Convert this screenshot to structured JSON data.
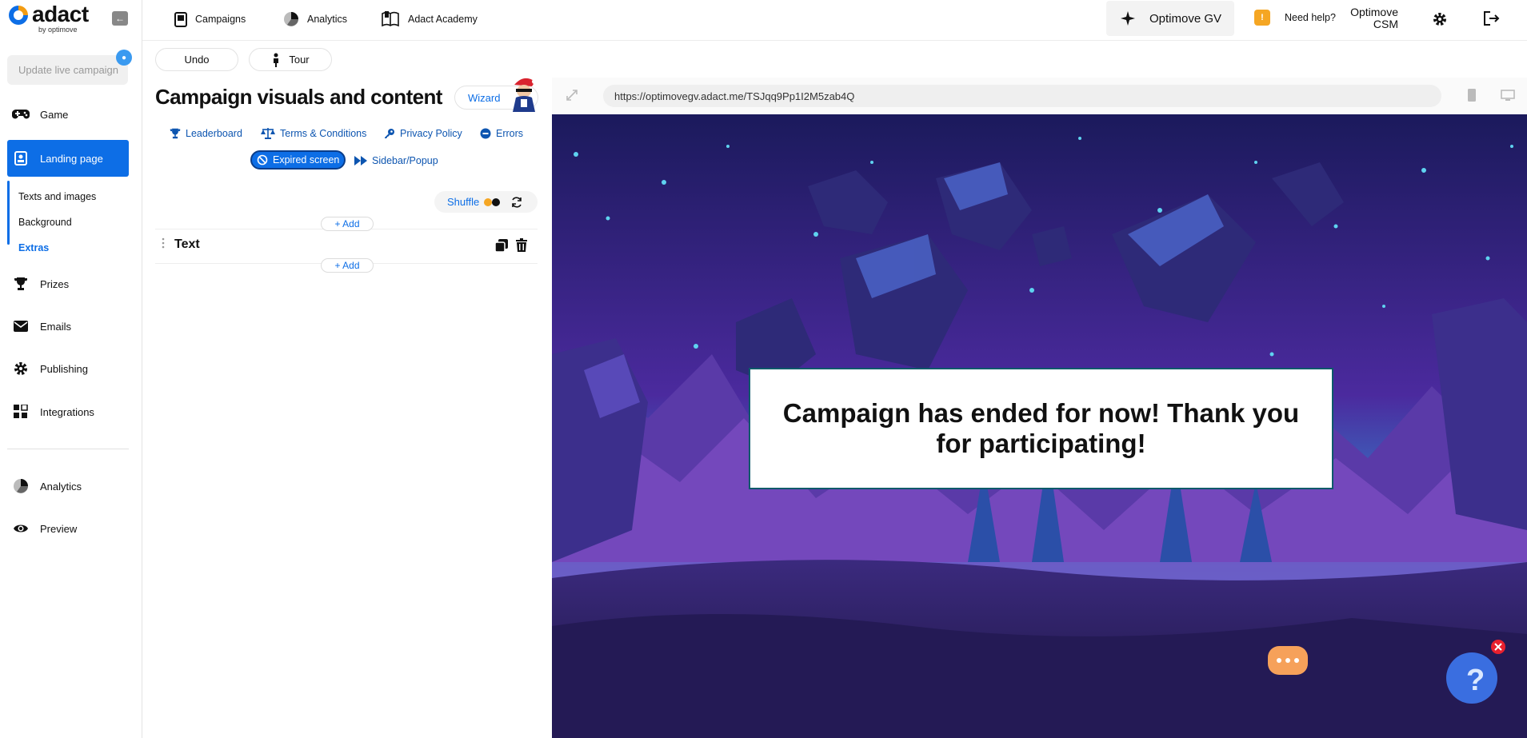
{
  "brand": {
    "name": "adact",
    "tagline": "by optimove"
  },
  "sidebar": {
    "update_label": "Update live campaign",
    "items": [
      {
        "label": "Game",
        "icon": "gamepad-icon"
      },
      {
        "label": "Landing page",
        "icon": "landing-page-icon"
      },
      {
        "label": "Prizes",
        "icon": "trophy-icon"
      },
      {
        "label": "Emails",
        "icon": "envelope-icon"
      },
      {
        "label": "Publishing",
        "icon": "gear-icon"
      },
      {
        "label": "Integrations",
        "icon": "grid-icon"
      },
      {
        "label": "Analytics",
        "icon": "pie-chart-icon"
      },
      {
        "label": "Preview",
        "icon": "eye-icon"
      }
    ],
    "subitems": [
      {
        "label": "Texts and images"
      },
      {
        "label": "Background"
      },
      {
        "label": "Extras"
      }
    ]
  },
  "header": {
    "links": [
      {
        "label": "Campaigns",
        "icon": "book-icon"
      },
      {
        "label": "Analytics",
        "icon": "pie-chart-icon"
      },
      {
        "label": "Adact Academy",
        "icon": "open-book-icon"
      }
    ],
    "account": "Optimove GV",
    "help_badge": "!",
    "help": "Need help?",
    "user_line1": "Optimove",
    "user_line2": "CSM"
  },
  "editor": {
    "undo_label": "Undo",
    "tour_label": "Tour",
    "title": "Campaign visuals and content",
    "wizard_label": "Wizard",
    "tabs": [
      {
        "label": "Leaderboard",
        "icon": "trophy-icon"
      },
      {
        "label": "Terms & Conditions",
        "icon": "scale-icon"
      },
      {
        "label": "Privacy Policy",
        "icon": "key-icon"
      },
      {
        "label": "Errors",
        "icon": "minus-circle-icon"
      },
      {
        "label": "Expired screen",
        "icon": "ban-icon"
      },
      {
        "label": "Sidebar/Popup",
        "icon": "fast-forward-icon"
      }
    ],
    "shuffle_label": "Shuffle",
    "add_label": "+ Add",
    "block_label": "Text"
  },
  "preview": {
    "url": "https://optimovegv.adact.me/TSJqq9Pp1I2M5zab4Q",
    "message": "Campaign has ended for now! Thank you for participating!"
  },
  "colors": {
    "accent": "#0d6ee6",
    "help_badge": "#f5a623",
    "shuffle_dot_1": "#f5a623",
    "shuffle_dot_2": "#111111"
  }
}
